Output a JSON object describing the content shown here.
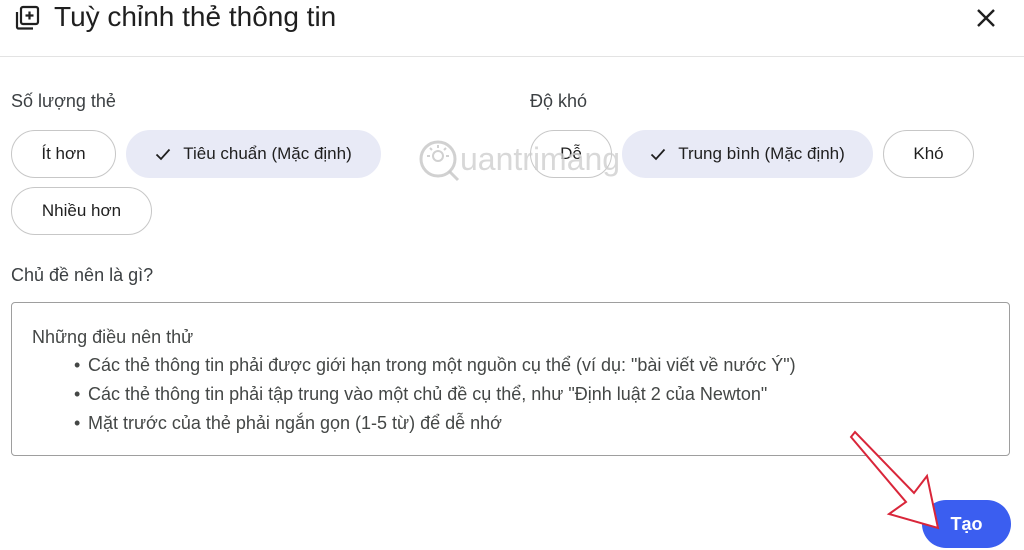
{
  "dialog": {
    "title": "Tuỳ chỉnh thẻ thông tin",
    "header_icon": "add-to-library-icon",
    "close_icon": "close-icon"
  },
  "card_count": {
    "label": "Số lượng thẻ",
    "options": [
      {
        "label": "Ít hơn",
        "selected": false
      },
      {
        "label": "Tiêu chuẩn (Mặc định)",
        "selected": true
      },
      {
        "label": "Nhiều hơn",
        "selected": false
      }
    ]
  },
  "difficulty": {
    "label": "Độ khó",
    "options": [
      {
        "label": "Dễ",
        "selected": false
      },
      {
        "label": "Trung bình (Mặc định)",
        "selected": true
      },
      {
        "label": "Khó",
        "selected": false
      }
    ]
  },
  "topic": {
    "label": "Chủ đề nên là gì?",
    "placeholder_title": "Những điều nên thử",
    "hints": [
      "Các thẻ thông tin phải được giới hạn trong một nguồn cụ thể (ví dụ: \"bài viết về nước Ý\")",
      "Các thẻ thông tin phải tập trung vào một chủ đề cụ thể, như \"Định luật 2 của Newton\"",
      "Mặt trước của thẻ phải ngắn gọn (1-5 từ) để dễ nhớ"
    ]
  },
  "actions": {
    "create_label": "Tạo"
  },
  "watermark": {
    "text": "uantrimang"
  },
  "colors": {
    "accent": "#3b5ef0",
    "chip_selected": "#e8eaf6",
    "annotation_arrow": "#d9263a"
  }
}
